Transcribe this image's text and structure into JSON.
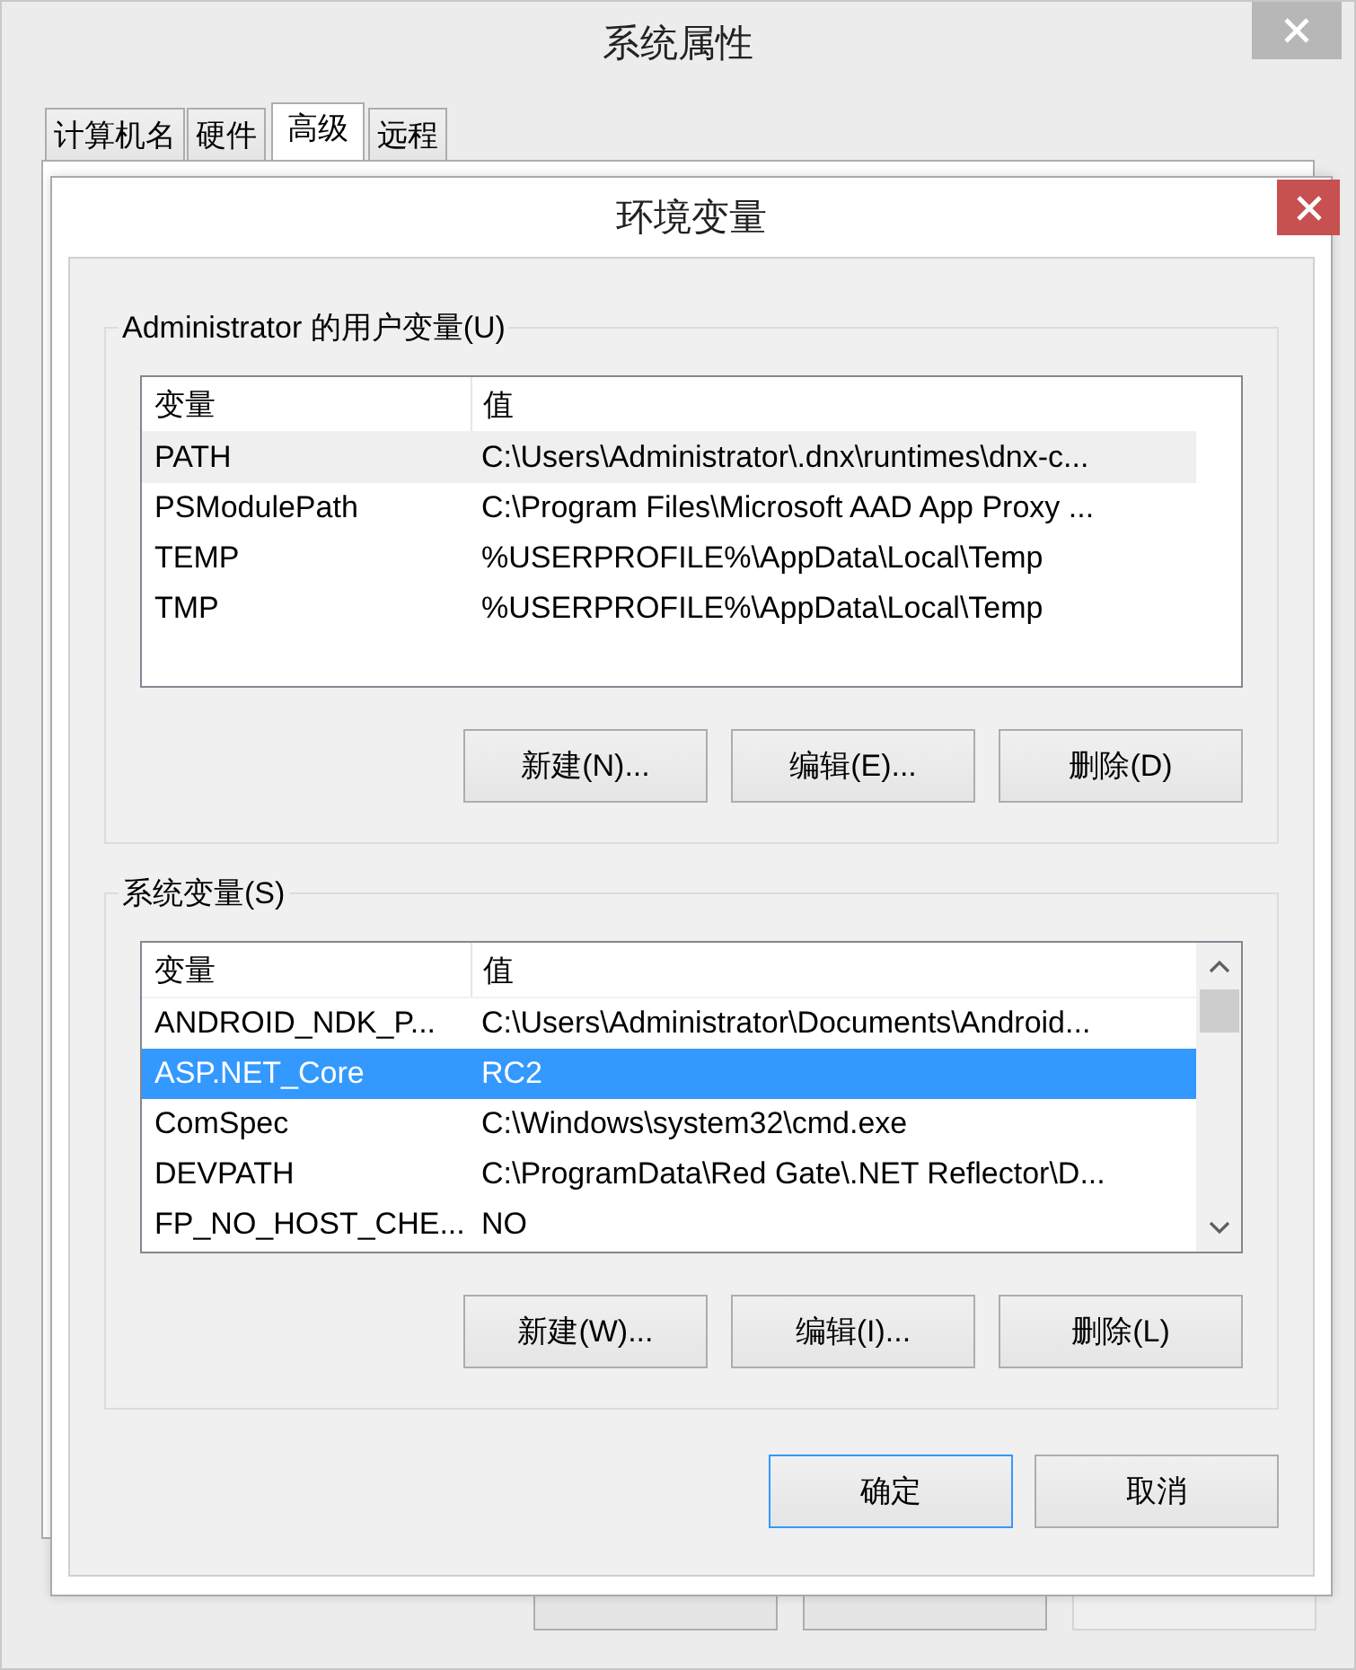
{
  "window": {
    "title": "系统属性"
  },
  "tabs": [
    {
      "label": "计算机名",
      "selected": false
    },
    {
      "label": "硬件",
      "selected": false
    },
    {
      "label": "高级",
      "selected": true
    },
    {
      "label": "远程",
      "selected": false
    }
  ],
  "background_buttons": [
    {
      "disabled": false
    },
    {
      "disabled": false
    },
    {
      "disabled": true
    }
  ],
  "dialog": {
    "title": "环境变量",
    "groups": [
      {
        "label": "Administrator 的用户变量(U)",
        "focused": false,
        "scrollbar": false,
        "columns": [
          "变量",
          "值"
        ],
        "rows": [
          {
            "name": "PATH",
            "value": "C:\\Users\\Administrator\\.dnx\\runtimes\\dnx-c...",
            "selected": true
          },
          {
            "name": "PSModulePath",
            "value": "C:\\Program Files\\Microsoft AAD App Proxy ...",
            "selected": false
          },
          {
            "name": "TEMP",
            "value": "%USERPROFILE%\\AppData\\Local\\Temp",
            "selected": false
          },
          {
            "name": "TMP",
            "value": "%USERPROFILE%\\AppData\\Local\\Temp",
            "selected": false
          }
        ],
        "buttons": [
          "新建(N)...",
          "编辑(E)...",
          "删除(D)"
        ]
      },
      {
        "label": "系统变量(S)",
        "focused": true,
        "scrollbar": true,
        "columns": [
          "变量",
          "值"
        ],
        "rows": [
          {
            "name": "ANDROID_NDK_P...",
            "value": "C:\\Users\\Administrator\\Documents\\Android...",
            "selected": false
          },
          {
            "name": "ASP.NET_Core",
            "value": "RC2",
            "selected": true
          },
          {
            "name": "ComSpec",
            "value": "C:\\Windows\\system32\\cmd.exe",
            "selected": false
          },
          {
            "name": "DEVPATH",
            "value": "C:\\ProgramData\\Red Gate\\.NET Reflector\\D...",
            "selected": false
          },
          {
            "name": "FP_NO_HOST_CHE...",
            "value": "NO",
            "selected": false
          }
        ],
        "buttons": [
          "新建(W)...",
          "编辑(I)...",
          "删除(L)"
        ]
      }
    ],
    "footer_buttons": [
      {
        "label": "确定",
        "default": true
      },
      {
        "label": "取消",
        "default": false
      }
    ]
  }
}
